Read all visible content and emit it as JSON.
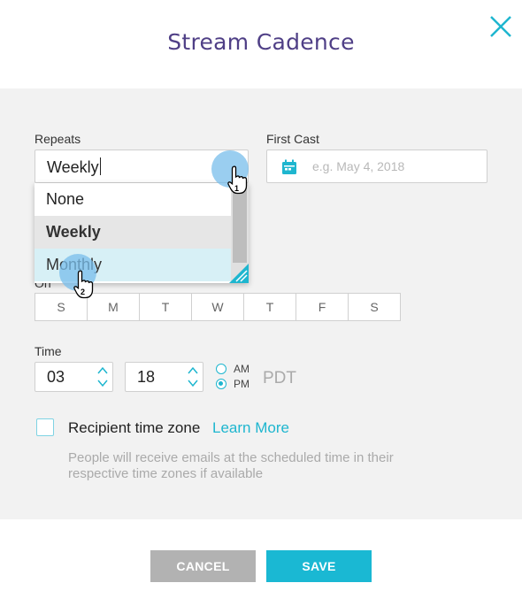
{
  "dialog": {
    "title": "Stream Cadence",
    "close_icon": "close-icon"
  },
  "form": {
    "repeats_label": "Repeats",
    "repeats_value": "Weekly",
    "repeats_options": [
      "None",
      "Weekly",
      "Monthly"
    ],
    "first_cast_label": "First Cast",
    "first_cast_placeholder": "e.g. May 4, 2018",
    "on_label": "On",
    "days": [
      "S",
      "M",
      "T",
      "W",
      "T",
      "F",
      "S"
    ],
    "time_label": "Time",
    "hour": "03",
    "minute": "18",
    "am_label": "AM",
    "pm_label": "PM",
    "selected_period": "PM",
    "timezone": "PDT",
    "recipient_tz_label": "Recipient time zone",
    "learn_more": "Learn More",
    "help_text": "People will receive emails at the scheduled time in their respective time zones if available"
  },
  "annotations": {
    "step1": "1",
    "step2": "2"
  },
  "buttons": {
    "cancel": "CANCEL",
    "save": "SAVE"
  },
  "colors": {
    "accent": "#1ab8d3",
    "title": "#4f3f86",
    "cancel": "#b2b2b2"
  }
}
